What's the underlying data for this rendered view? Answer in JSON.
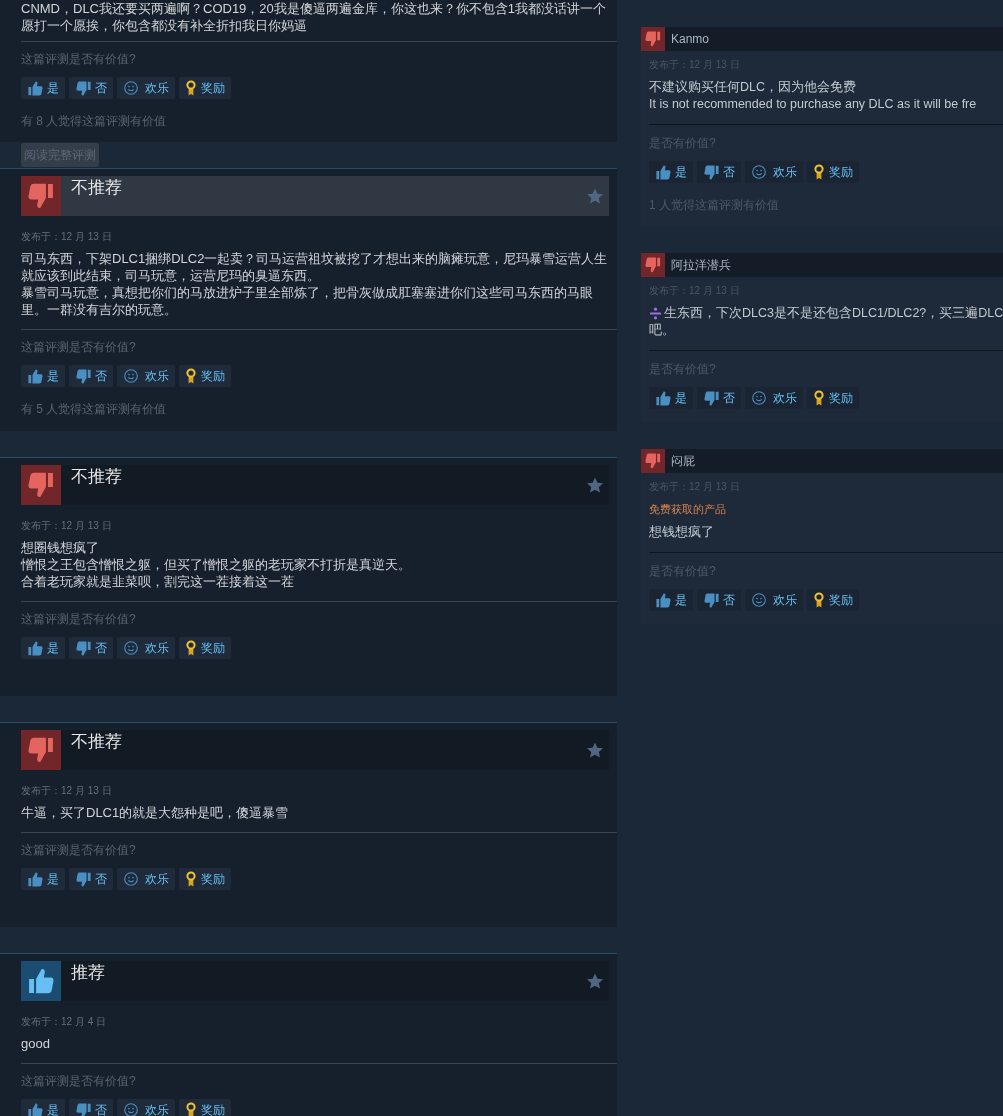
{
  "left_reviews": [
    {
      "body": [
        "CNMD，DLC我还要买两遍啊？COD19，20我是傻逼两遍金库，你这也来？你不包含1我都没话讲一个愿打一个愿挨，你包含都没有补全折扣我日你妈逼"
      ],
      "helpful_question": "这篇评测是否有价值?",
      "vote_buttons": [
        {
          "kind": "yes",
          "label": "是"
        },
        {
          "kind": "no",
          "label": "否"
        },
        {
          "kind": "funny",
          "label": "欢乐"
        },
        {
          "kind": "award",
          "label": "奖励"
        }
      ],
      "helpful_count": "有 8 人觉得这篇评测有价值",
      "read_more": "阅读完整评测"
    },
    {
      "recommended": false,
      "verdict": "不推荐",
      "highlighted": true,
      "posted": "发布于：12 月 13 日",
      "body": [
        "司马东西，下架DLC1捆绑DLC2一起卖？司马运营祖坟被挖了才想出来的脑瘫玩意，尼玛暴雪运营人生就应该到此结束，司马玩意，运营尼玛的臭逼东西。",
        "暴雪司马玩意，真想把你们的马放进炉子里全部炼了，把骨灰做成肛塞塞进你们这些司马东西的马眼里。一群没有吉尔的玩意。"
      ],
      "helpful_question": "这篇评测是否有价值?",
      "vote_buttons": [
        {
          "kind": "yes",
          "label": "是"
        },
        {
          "kind": "no",
          "label": "否"
        },
        {
          "kind": "funny",
          "label": "欢乐"
        },
        {
          "kind": "award",
          "label": "奖励"
        }
      ],
      "helpful_count": "有 5 人觉得这篇评测有价值"
    },
    {
      "recommended": false,
      "verdict": "不推荐",
      "highlighted": false,
      "posted": "发布于：12 月 13 日",
      "body": [
        "想圈钱想疯了",
        "憎恨之王包含憎恨之躯，但买了憎恨之躯的老玩家不打折是真逆天。",
        "合着老玩家就是韭菜呗，割完这一茬接着这一茬"
      ],
      "helpful_question": "这篇评测是否有价值?",
      "vote_buttons": [
        {
          "kind": "yes",
          "label": "是"
        },
        {
          "kind": "no",
          "label": "否"
        },
        {
          "kind": "funny",
          "label": "欢乐"
        },
        {
          "kind": "award",
          "label": "奖励"
        }
      ]
    },
    {
      "recommended": false,
      "verdict": "不推荐",
      "highlighted": false,
      "posted": "发布于：12 月 13 日",
      "body": [
        "牛逼，买了DLC1的就是大怨种是吧，傻逼暴雪"
      ],
      "helpful_question": "这篇评测是否有价值?",
      "vote_buttons": [
        {
          "kind": "yes",
          "label": "是"
        },
        {
          "kind": "no",
          "label": "否"
        },
        {
          "kind": "funny",
          "label": "欢乐"
        },
        {
          "kind": "award",
          "label": "奖励"
        }
      ]
    },
    {
      "recommended": true,
      "verdict": "推荐",
      "highlighted": false,
      "posted": "发布于：12 月 4 日",
      "body": [
        "good"
      ],
      "helpful_question": "这篇评测是否有价值?",
      "vote_buttons": [
        {
          "kind": "yes",
          "label": "是"
        },
        {
          "kind": "no",
          "label": "否"
        },
        {
          "kind": "funny",
          "label": "欢乐"
        },
        {
          "kind": "award",
          "label": "奖励"
        }
      ]
    }
  ],
  "right_reviews": [
    {
      "recommended": false,
      "author": "Kanmo",
      "posted": "发布于：12 月 13 日",
      "body": [
        {
          "kind": "plain",
          "text": "不建议购买任何DLC，因为他会免费"
        },
        {
          "kind": "plain",
          "text": "It is not recommended to purchase any DLC as it will be fre"
        }
      ],
      "helpful_question": "是否有价值?",
      "vote_buttons": [
        {
          "kind": "yes",
          "label": "是"
        },
        {
          "kind": "no",
          "label": "否"
        },
        {
          "kind": "funny",
          "label": "欢乐"
        },
        {
          "kind": "award",
          "label": "奖励"
        }
      ],
      "helpful_count": "1 人觉得这篇评测有价值"
    },
    {
      "recommended": false,
      "author": "阿拉洋潜兵",
      "posted": "发布于：12 月 13 日",
      "body": [
        {
          "kind": "emoji_lead",
          "text": "生东西，下次DLC3是不是还包含DLC1/DLC2?，买三遍DLC"
        },
        {
          "kind": "plain",
          "text": "吧。"
        }
      ],
      "helpful_question": "是否有价值?",
      "vote_buttons": [
        {
          "kind": "yes",
          "label": "是"
        },
        {
          "kind": "no",
          "label": "否"
        },
        {
          "kind": "funny",
          "label": "欢乐"
        },
        {
          "kind": "award",
          "label": "奖励"
        }
      ]
    },
    {
      "recommended": false,
      "author": "闷屁",
      "posted": "发布于：12 月 13 日",
      "source_note": "免费获取的产品",
      "body": [
        {
          "kind": "plain",
          "text": "想钱想疯了"
        }
      ],
      "helpful_question": "是否有价值?",
      "vote_buttons": [
        {
          "kind": "yes",
          "label": "是"
        },
        {
          "kind": "no",
          "label": "否"
        },
        {
          "kind": "funny",
          "label": "欢乐"
        },
        {
          "kind": "award",
          "label": "奖励"
        }
      ]
    }
  ]
}
